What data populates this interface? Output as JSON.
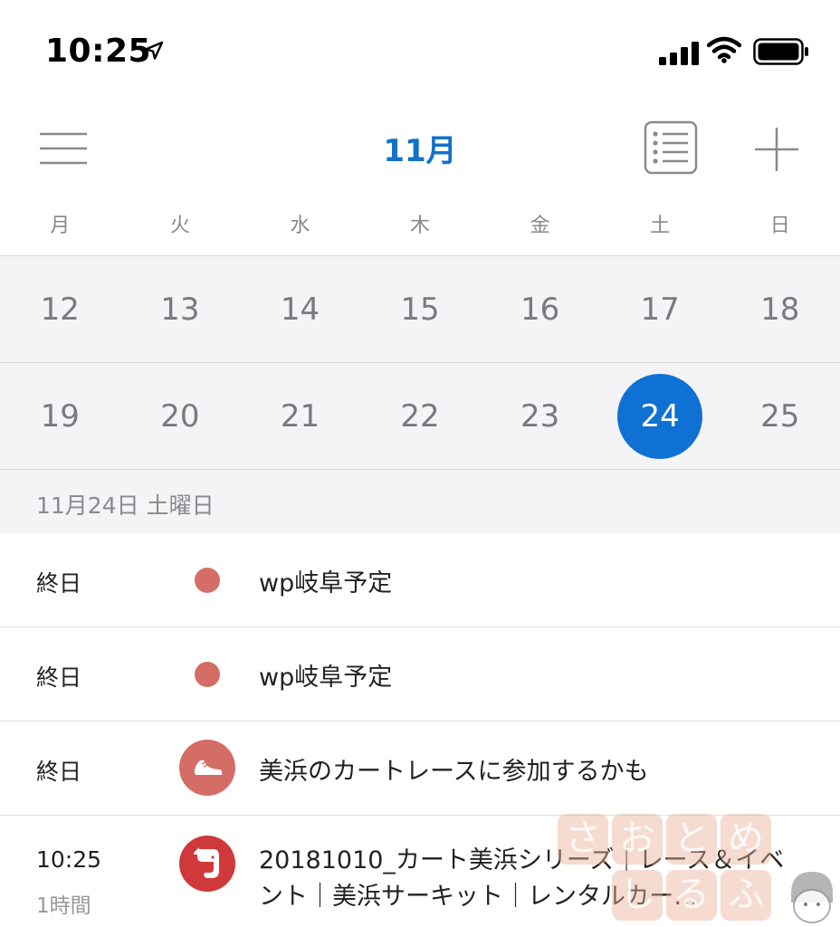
{
  "status_bar": {
    "time": "10:25"
  },
  "header": {
    "title": "11月"
  },
  "weekdays": [
    "月",
    "火",
    "水",
    "木",
    "金",
    "土",
    "日"
  ],
  "weeks": [
    [
      "12",
      "13",
      "14",
      "15",
      "16",
      "17",
      "18"
    ],
    [
      "19",
      "20",
      "21",
      "22",
      "23",
      "24",
      "25"
    ]
  ],
  "selected_day": "24",
  "date_heading": "11月24日 土曜日",
  "events": [
    {
      "time": "終日",
      "title": "wp岐阜予定",
      "marker": "dot",
      "color": "#d36d66"
    },
    {
      "time": "終日",
      "title": "wp岐阜予定",
      "marker": "dot",
      "color": "#d36d66"
    },
    {
      "time": "終日",
      "title": "美浜のカートレースに参加するかも",
      "marker": "shoe-icon",
      "color": "#d36d66"
    },
    {
      "time": "10:25",
      "duration": "1時間",
      "title": "20181010_カート美浜シリーズ｜レース＆イベント｜美浜サーキット｜レンタルカー…",
      "marker": "evernote-icon",
      "color": "#d0393b"
    }
  ],
  "watermark": {
    "row1": [
      "さ",
      "お",
      "と",
      "め"
    ],
    "row2": [
      "し",
      "る",
      "ふ"
    ]
  },
  "colors": {
    "accent": "#1271c9",
    "selected": "#0f71d4",
    "calendar_bg": "#f4f4f6"
  }
}
